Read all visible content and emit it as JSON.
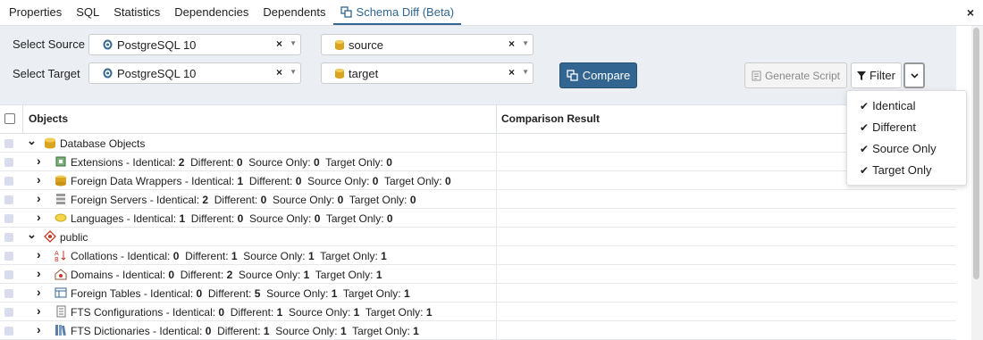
{
  "tabs": [
    "Properties",
    "SQL",
    "Statistics",
    "Dependencies",
    "Dependents",
    "Schema Diff (Beta)"
  ],
  "close_label": "×",
  "source": {
    "label": "Select Source",
    "server": "PostgreSQL 10",
    "database": "source"
  },
  "target": {
    "label": "Select Target",
    "server": "PostgreSQL 10",
    "database": "target"
  },
  "clear_glyph": "×",
  "buttons": {
    "compare": "Compare",
    "generate": "Generate Script",
    "filter": "Filter"
  },
  "filter_menu": [
    "Identical",
    "Different",
    "Source Only",
    "Target Only"
  ],
  "grid": {
    "col_objects": "Objects",
    "col_result": "Comparison Result"
  },
  "labels": {
    "identical": "Identical:",
    "different": "Different:",
    "source_only": "Source Only:",
    "target_only": "Target Only:"
  },
  "rows": [
    {
      "name": "Database Objects",
      "level": 0,
      "icon": "database-icon"
    },
    {
      "name": "Extensions - ",
      "level": 1,
      "icon": "extension-icon",
      "identical": "2",
      "different": "0",
      "source_only": "0",
      "target_only": "0"
    },
    {
      "name": "Foreign Data Wrappers - ",
      "level": 1,
      "icon": "fdw-icon",
      "identical": "1",
      "different": "0",
      "source_only": "0",
      "target_only": "0"
    },
    {
      "name": "Foreign Servers - ",
      "level": 1,
      "icon": "foreign-server-icon",
      "identical": "2",
      "different": "0",
      "source_only": "0",
      "target_only": "0"
    },
    {
      "name": "Languages - ",
      "level": 1,
      "icon": "language-icon",
      "identical": "1",
      "different": "0",
      "source_only": "0",
      "target_only": "0"
    },
    {
      "name": "public",
      "level": 0,
      "icon": "schema-icon"
    },
    {
      "name": "Collations - ",
      "level": 1,
      "icon": "collation-icon",
      "identical": "0",
      "different": "1",
      "source_only": "1",
      "target_only": "1"
    },
    {
      "name": "Domains - ",
      "level": 1,
      "icon": "domain-icon",
      "identical": "0",
      "different": "2",
      "source_only": "1",
      "target_only": "1"
    },
    {
      "name": "Foreign Tables - ",
      "level": 1,
      "icon": "foreign-table-icon",
      "identical": "0",
      "different": "5",
      "source_only": "1",
      "target_only": "1"
    },
    {
      "name": "FTS Configurations - ",
      "level": 1,
      "icon": "fts-config-icon",
      "identical": "0",
      "different": "1",
      "source_only": "1",
      "target_only": "1"
    },
    {
      "name": "FTS Dictionaries - ",
      "level": 1,
      "icon": "fts-dictionary-icon",
      "identical": "0",
      "different": "1",
      "source_only": "1",
      "target_only": "1"
    }
  ],
  "colors": {
    "accent": "#326690",
    "panel_bg": "#ebeef3",
    "checkbox": "#d8dcec"
  }
}
